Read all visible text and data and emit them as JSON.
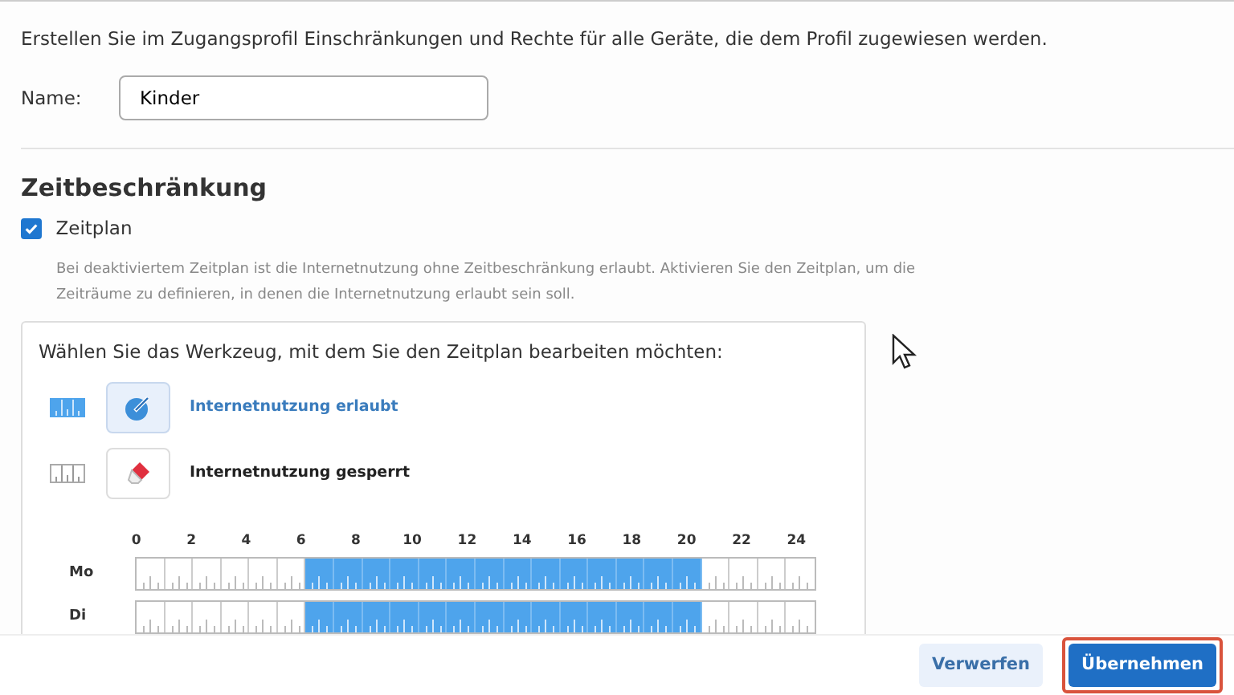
{
  "intro": "Erstellen Sie im Zugangsprofil Einschränkungen und Rechte für alle Geräte, die dem Profil zugewiesen werden.",
  "name_field": {
    "label": "Name:",
    "value": "Kinder"
  },
  "section": {
    "title": "Zeitbeschränkung",
    "schedule": {
      "label": "Zeitplan",
      "checked": true,
      "description": "Bei deaktiviertem Zeitplan ist die Internetnutzung ohne Zeitbeschränkung erlaubt. Aktivieren Sie den Zeitplan, um die Zeiträume zu definieren, in denen die Internetnutzung erlaubt sein soll."
    },
    "tool_card": {
      "title": "Wählen Sie das Werkzeug, mit dem Sie den Zeitplan bearbeiten möchten:",
      "tools": [
        {
          "kind": "allowed",
          "label": "Internetnutzung erlaubt",
          "selected": true
        },
        {
          "kind": "blocked",
          "label": "Internetnutzung gesperrt",
          "selected": false
        }
      ],
      "hour_labels": [
        "0",
        "2",
        "4",
        "6",
        "8",
        "10",
        "12",
        "14",
        "16",
        "18",
        "20",
        "22",
        "24"
      ],
      "days": [
        {
          "label": "Mo",
          "hours": [
            false,
            false,
            false,
            false,
            false,
            false,
            true,
            true,
            true,
            true,
            true,
            true,
            true,
            true,
            true,
            true,
            true,
            true,
            true,
            true,
            false,
            false,
            false,
            false
          ]
        },
        {
          "label": "Di",
          "hours": [
            false,
            false,
            false,
            false,
            false,
            false,
            true,
            true,
            true,
            true,
            true,
            true,
            true,
            true,
            true,
            true,
            true,
            true,
            true,
            true,
            false,
            false,
            false,
            false
          ]
        }
      ]
    }
  },
  "footer": {
    "buttons": [
      {
        "kind": "secondary",
        "label": "Verwerfen",
        "highlighted": false
      },
      {
        "kind": "primary",
        "label": "Übernehmen",
        "highlighted": true
      }
    ]
  }
}
